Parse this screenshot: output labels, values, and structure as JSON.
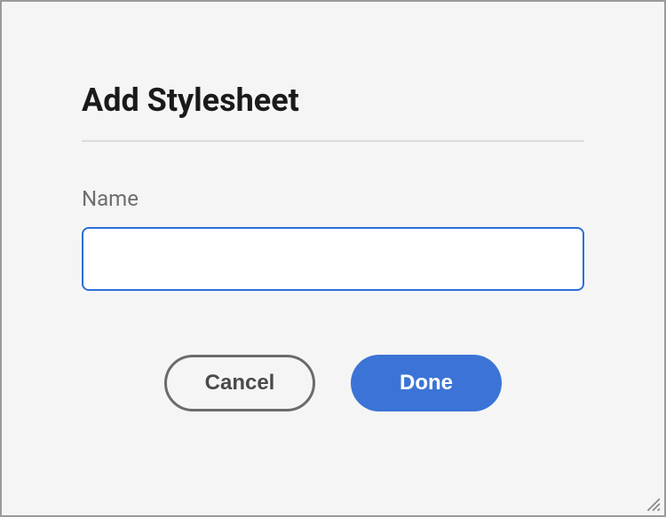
{
  "dialog": {
    "title": "Add Stylesheet",
    "field": {
      "label": "Name",
      "value": "",
      "placeholder": ""
    },
    "buttons": {
      "cancel": "Cancel",
      "done": "Done"
    }
  }
}
